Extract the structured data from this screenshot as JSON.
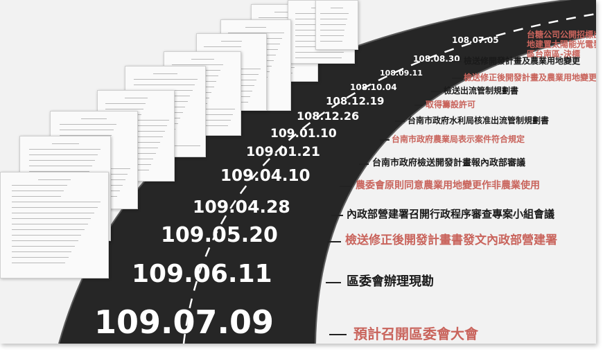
{
  "colors": {
    "road": "#262626",
    "road_edge": "#5a5a5a",
    "background": "#f2f2f2",
    "event_black": "#1a1a1a",
    "event_red": "#c9645c",
    "date_text": "#ffffff"
  },
  "timeline": [
    {
      "date": "108.07.05",
      "event": "台糖公司公開招標出租",
      "event2": "地建置太陽能光電發電",
      "event3": "區台南區-決標",
      "color": "red"
    },
    {
      "date": "108.08.30",
      "event": "檢送修開發計畫及農業用地變更",
      "color": "black"
    },
    {
      "date": "108.09.11",
      "event": "檢送修正後開發計畫及農業用地變更",
      "color": "red"
    },
    {
      "date": "108.10.04",
      "event": "檢送出流管制規劃書",
      "color": "black"
    },
    {
      "date": "108.12.19",
      "event": "取得籌設許可",
      "color": "red"
    },
    {
      "date": "108.12.26",
      "event": "台南市政府水利局核准出流管制規劃書",
      "color": "black"
    },
    {
      "date": "109.01.10",
      "event": "台南市政府農業局表示案件符合規定",
      "color": "red"
    },
    {
      "date": "109.01.21",
      "event": "台南市政府檢送開發計畫報內政部審議",
      "color": "black"
    },
    {
      "date": "109.04.10",
      "event": "農委會原則同意農業用地變更作非農業使用",
      "color": "red"
    },
    {
      "date": "109.04.28",
      "event": "內政部營建署召開行政程序審查專案小組會議",
      "color": "black"
    },
    {
      "date": "109.05.20",
      "event": "檢送修正後開發計畫書發文內政部營建署",
      "color": "red"
    },
    {
      "date": "109.06.11",
      "event": "區委會辦理現勘",
      "color": "black"
    },
    {
      "date": "109.07.09",
      "event": "預計召開區委會大會",
      "color": "red"
    }
  ]
}
